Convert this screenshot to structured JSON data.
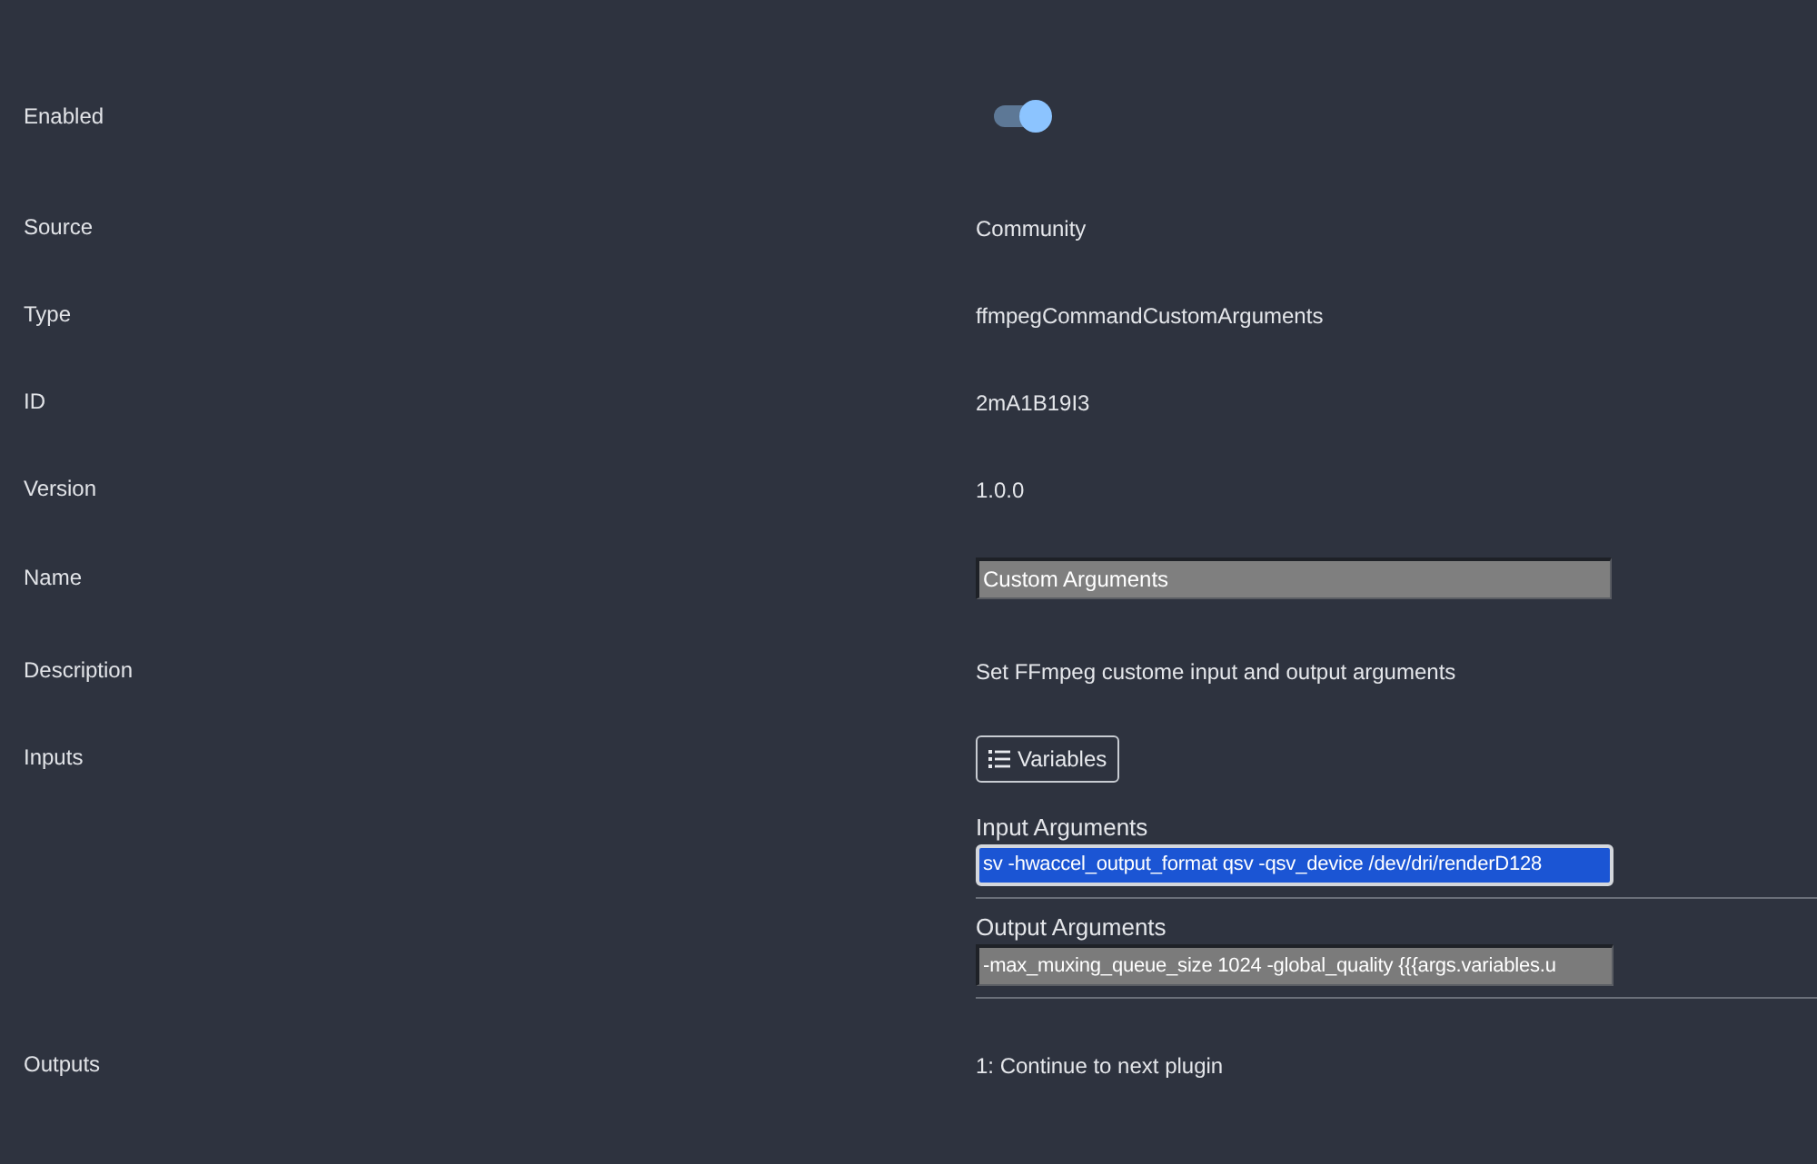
{
  "fields": [
    {
      "kind": "toggle",
      "label": "Enabled",
      "on": true
    },
    {
      "kind": "text",
      "label": "Source",
      "value": "Community"
    },
    {
      "kind": "text",
      "label": "Type",
      "value": "ffmpegCommandCustomArguments"
    },
    {
      "kind": "text",
      "label": "ID",
      "value": "2mA1B19I3"
    },
    {
      "kind": "text",
      "label": "Version",
      "value": "1.0.0"
    },
    {
      "kind": "input",
      "label": "Name",
      "value": "Custom Arguments"
    },
    {
      "kind": "text",
      "label": "Description",
      "value": "Set FFmpeg custome input and output arguments"
    },
    {
      "kind": "inputs",
      "label": "Inputs",
      "button": "Variables",
      "inputs": [
        {
          "label": "Input Arguments",
          "value": "sv -hwaccel_output_format qsv -qsv_device /dev/dri/renderD128",
          "focused": true,
          "text_selected": true
        },
        {
          "label": "Output Arguments",
          "value": "-max_muxing_queue_size 1024 -global_quality {{{args.variables.u",
          "focused": false,
          "text_selected": false
        }
      ]
    },
    {
      "kind": "text",
      "label": "Outputs",
      "value": "1: Continue to next plugin"
    }
  ]
}
